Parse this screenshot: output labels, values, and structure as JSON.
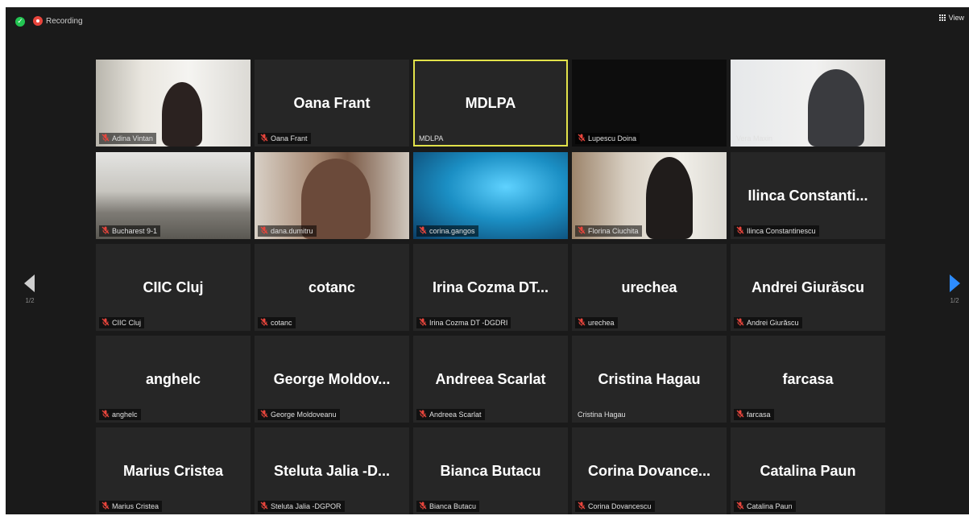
{
  "topbar": {
    "recording_label": "Recording",
    "view_label": "View"
  },
  "nav": {
    "prev_page": "1/2",
    "next_page": "1/2"
  },
  "tiles": [
    {
      "display": "",
      "label": "Adina Vintan",
      "muted": true,
      "video": "v-adina"
    },
    {
      "display": "Oana Frant",
      "label": "Oana Frant",
      "muted": true
    },
    {
      "display": "MDLPA",
      "label": "MDLPA",
      "muted": false,
      "active": true
    },
    {
      "display": "",
      "label": "Lupescu Doina",
      "muted": true,
      "video": "v-dark"
    },
    {
      "display": "",
      "label": "Vera Maxin",
      "muted": false,
      "video": "v-vera"
    },
    {
      "display": "",
      "label": "Bucharest 9-1",
      "muted": true,
      "video": "v-room"
    },
    {
      "display": "",
      "label": "dana.dumitru",
      "muted": true,
      "video": "v-dana"
    },
    {
      "display": "",
      "label": "corina.gangos",
      "muted": true,
      "video": "v-corina"
    },
    {
      "display": "",
      "label": "Florina Ciuchita",
      "muted": true,
      "video": "v-florina"
    },
    {
      "display": "Ilinca  Constanti...",
      "label": "Ilinca Constantinescu",
      "muted": true
    },
    {
      "display": "CIIC Cluj",
      "label": "CIIC Cluj",
      "muted": true
    },
    {
      "display": "cotanc",
      "label": "cotanc",
      "muted": true
    },
    {
      "display": "Irina Cozma DT...",
      "label": "Irina Cozma DT -DGDRI",
      "muted": true
    },
    {
      "display": "urechea",
      "label": "urechea",
      "muted": true
    },
    {
      "display": "Andrei Giurăscu",
      "label": "Andrei Giurăscu",
      "muted": true
    },
    {
      "display": "anghelc",
      "label": "anghelc",
      "muted": true
    },
    {
      "display": "George  Moldov...",
      "label": "George Moldoveanu",
      "muted": true
    },
    {
      "display": "Andreea Scarlat",
      "label": "Andreea Scarlat",
      "muted": true
    },
    {
      "display": "Cristina Hagau",
      "label": "Cristina Hagau",
      "muted": false
    },
    {
      "display": "farcasa",
      "label": "farcasa",
      "muted": true
    },
    {
      "display": "Marius Cristea",
      "label": "Marius Cristea",
      "muted": true
    },
    {
      "display": "Steluta  Jalia  -D...",
      "label": "Steluta Jalia -DGPOR",
      "muted": true
    },
    {
      "display": "Bianca Butacu",
      "label": "Bianca Butacu",
      "muted": true
    },
    {
      "display": "Corina  Dovance...",
      "label": "Corina Dovancescu",
      "muted": true
    },
    {
      "display": "Catalina Paun",
      "label": "Catalina Paun",
      "muted": true
    }
  ]
}
